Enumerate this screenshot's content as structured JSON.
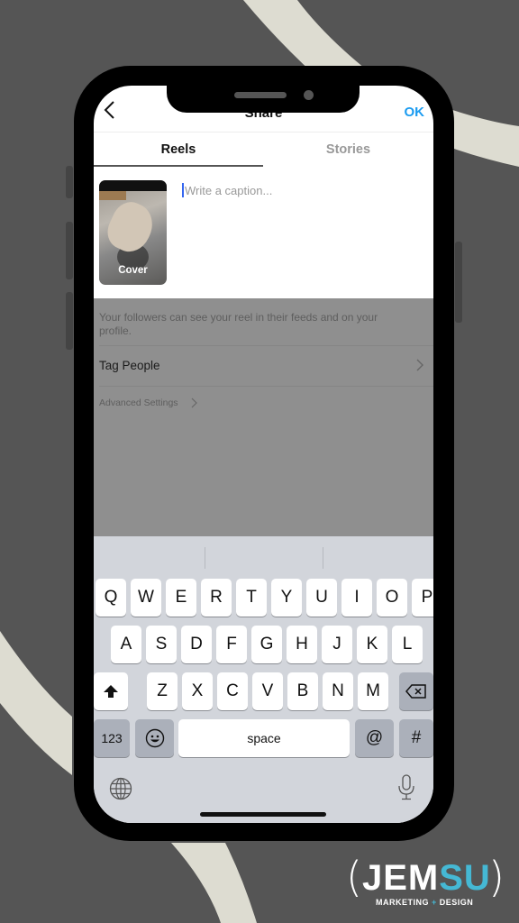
{
  "header": {
    "title": "Share",
    "ok_label": "OK",
    "back_icon": "chevron-left-icon",
    "ok_color": "#1a9bf0"
  },
  "tabs": [
    {
      "label": "Reels",
      "active": true
    },
    {
      "label": "Stories",
      "active": false
    }
  ],
  "compose": {
    "cover_label": "Cover",
    "caption_placeholder": "Write a caption..."
  },
  "options": {
    "note": "Your followers can see your reel in their feeds and on your profile.",
    "tag_people": "Tag People",
    "advanced_settings": "Advanced Settings"
  },
  "keyboard": {
    "row1": [
      "Q",
      "W",
      "E",
      "R",
      "T",
      "Y",
      "U",
      "I",
      "O",
      "P"
    ],
    "row2": [
      "A",
      "S",
      "D",
      "F",
      "G",
      "H",
      "J",
      "K",
      "L"
    ],
    "row3": [
      "Z",
      "X",
      "C",
      "V",
      "B",
      "N",
      "M"
    ],
    "numbers_key": "123",
    "space_key": "space",
    "at_key": "@",
    "hash_key": "#",
    "icons": {
      "shift": "shift-arrow-icon",
      "delete": "backspace-icon",
      "emoji": "emoji-icon",
      "globe": "globe-icon",
      "mic": "microphone-icon"
    }
  },
  "branding": {
    "logo_left": "JEM",
    "logo_right": "SU",
    "tagline_left": "MARKETING",
    "tagline_plus": "+",
    "tagline_right": "DESIGN",
    "accent_color": "#45b8d4"
  }
}
